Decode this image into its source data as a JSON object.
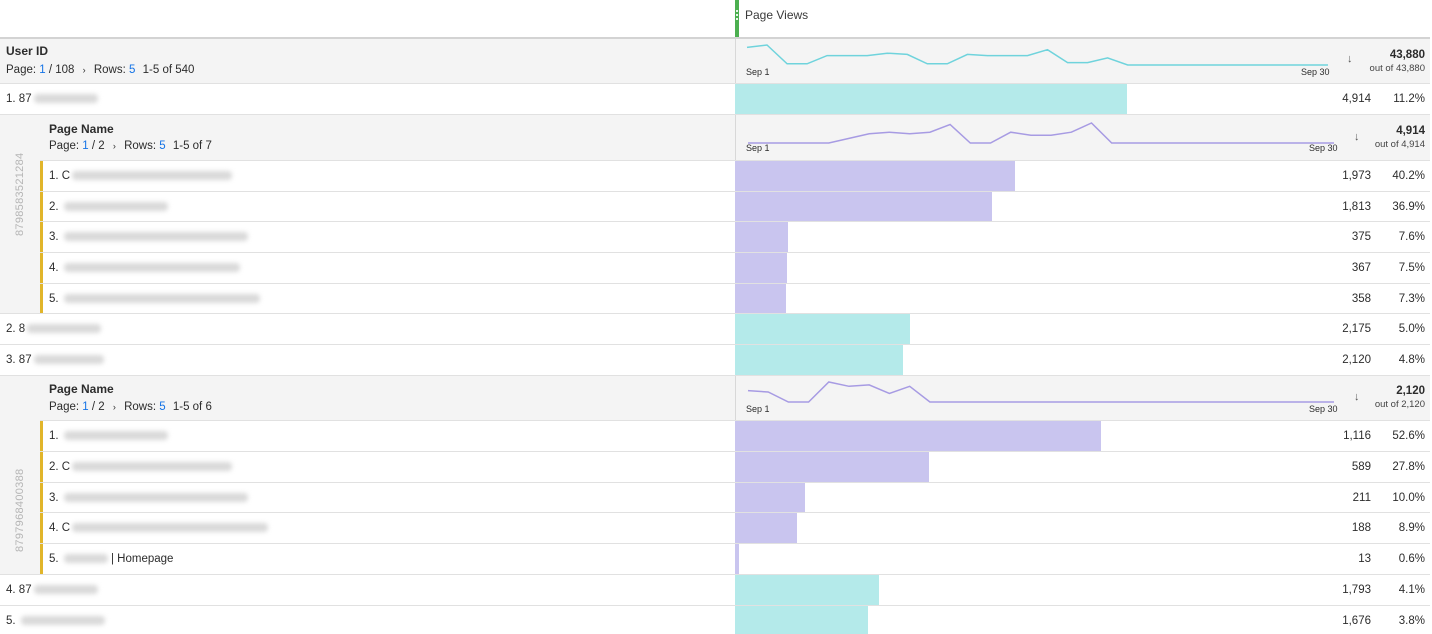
{
  "metric": {
    "title": "Page Views"
  },
  "top_dimension": {
    "title": "User ID",
    "page_label": "Page:",
    "page_current": "1",
    "page_total": "/ 108",
    "rows_label": "Rows:",
    "rows_value": "5",
    "range": "1-5 of 540",
    "total": "43,880",
    "out_of": "out of 43,880",
    "spark_start": "Sep 1",
    "spark_end": "Sep 30",
    "spark_color": "#6fd3dc",
    "spark_values": [
      20,
      22,
      6,
      6,
      13,
      13,
      13,
      15,
      14,
      6,
      6,
      14,
      13,
      13,
      13,
      18,
      7,
      7,
      11,
      5,
      5,
      5,
      5,
      5,
      5,
      5,
      5,
      5,
      5,
      5
    ]
  },
  "rows": [
    {
      "kind": "user",
      "index": "1.",
      "prefix": "87",
      "value": "4,914",
      "pct": "11.2%",
      "share": 0.112
    },
    {
      "kind": "breakdown",
      "vertical_id": "8798583521284",
      "header": {
        "title": "Page Name",
        "page_label": "Page:",
        "page_current": "1",
        "page_total": "/ 2",
        "rows_label": "Rows:",
        "rows_value": "5",
        "range": "1-5 of 7",
        "total": "4,914",
        "out_of": "out of 4,914",
        "spark_start": "Sep 1",
        "spark_end": "Sep 30",
        "spark_color": "#a79be3",
        "spark_values": [
          5,
          5,
          5,
          5,
          5,
          8,
          11,
          12,
          11,
          12,
          17,
          5,
          5,
          12,
          10,
          10,
          12,
          18,
          5,
          5,
          5,
          5,
          5,
          5,
          5,
          5,
          5,
          5,
          5,
          5
        ]
      },
      "items": [
        {
          "index": "1.",
          "prefix": "C",
          "value": "1,973",
          "pct": "40.2%",
          "share": 0.402
        },
        {
          "index": "2.",
          "prefix": "",
          "value": "1,813",
          "pct": "36.9%",
          "share": 0.369
        },
        {
          "index": "3.",
          "prefix": "",
          "value": "375",
          "pct": "7.6%",
          "share": 0.076
        },
        {
          "index": "4.",
          "prefix": "",
          "value": "367",
          "pct": "7.5%",
          "share": 0.075
        },
        {
          "index": "5.",
          "prefix": "",
          "value": "358",
          "pct": "7.3%",
          "share": 0.073
        }
      ]
    },
    {
      "kind": "user",
      "index": "2.",
      "prefix": "8",
      "value": "2,175",
      "pct": "5.0%",
      "share": 0.05
    },
    {
      "kind": "user",
      "index": "3.",
      "prefix": "87",
      "value": "2,120",
      "pct": "4.8%",
      "share": 0.048
    },
    {
      "kind": "breakdown",
      "vertical_id": "8797968400388",
      "header": {
        "title": "Page Name",
        "page_label": "Page:",
        "page_current": "1",
        "page_total": "/ 2",
        "rows_label": "Rows:",
        "rows_value": "5",
        "range": "1-5 of 6",
        "total": "2,120",
        "out_of": "out of 2,120",
        "spark_start": "Sep 1",
        "spark_end": "Sep 30",
        "spark_color": "#a79be3",
        "spark_values": [
          10,
          9,
          2,
          2,
          16,
          13,
          14,
          8,
          13,
          2,
          2,
          2,
          2,
          2,
          2,
          2,
          2,
          2,
          2,
          2,
          2,
          2,
          2,
          2,
          2,
          2,
          2,
          2,
          2,
          2
        ]
      },
      "items": [
        {
          "index": "1.",
          "prefix": "",
          "value": "1,116",
          "pct": "52.6%",
          "share": 0.526
        },
        {
          "index": "2.",
          "prefix": "C",
          "value": "589",
          "pct": "27.8%",
          "share": 0.278
        },
        {
          "index": "3.",
          "prefix": "",
          "value": "211",
          "pct": "10.0%",
          "share": 0.1
        },
        {
          "index": "4.",
          "prefix": "C",
          "value": "188",
          "pct": "8.9%",
          "share": 0.089
        },
        {
          "index": "5.",
          "prefix": "",
          "suffix": "| Homepage",
          "value": "13",
          "pct": "0.6%",
          "share": 0.006
        }
      ]
    },
    {
      "kind": "user",
      "index": "4.",
      "prefix": "87",
      "value": "1,793",
      "pct": "4.1%",
      "share": 0.041
    },
    {
      "kind": "user",
      "index": "5.",
      "prefix": "",
      "value": "1,676",
      "pct": "3.8%",
      "share": 0.038
    }
  ],
  "colors": {
    "user_bar": "#b4eaea",
    "page_bar": "#c9c5ef",
    "accent": "#e1b52a",
    "grip": "#4caf50",
    "link": "#1473e6"
  }
}
